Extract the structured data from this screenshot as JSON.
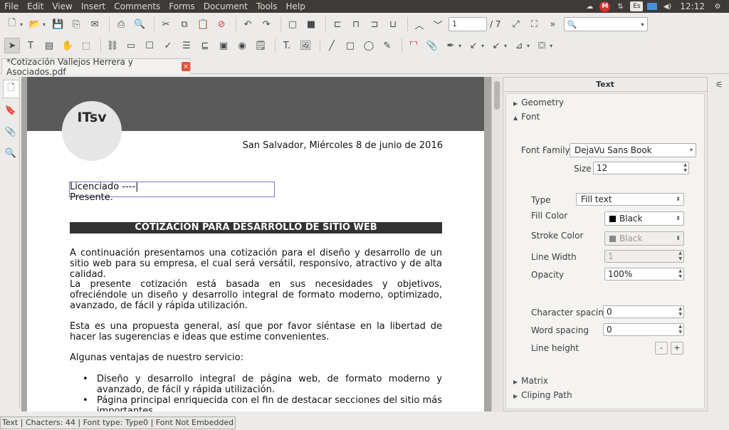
{
  "menu": [
    "File",
    "Edit",
    "View",
    "Insert",
    "Comments",
    "Forms",
    "Document",
    "Tools",
    "Help"
  ],
  "tray": {
    "language": "Es",
    "time": "12:12",
    "m_badge": "M"
  },
  "toolbar": {
    "page_current": "1",
    "page_total": "/ 7",
    "search_value": ""
  },
  "tab": {
    "title": "*Cotización Vallejos Herrera y Asociados.pdf",
    "close": "×"
  },
  "document": {
    "logo": "ITsv",
    "date_line": "San Salvador, Miércoles 8 de junio de 2016",
    "addressee": "Licenciado ----|",
    "salutation": "Presente.",
    "section_title": "COTIZACIÓN PARA DESARROLLO DE SITIO WEB",
    "paragraphs": [
      "A continuación presentamos una cotización para el diseño y desarrollo de un sitio web para su empresa, el cual será versátil, responsivo, atractivo y de alta calidad.",
      "La presente cotización está basada en sus necesidades y objetivos, ofreciéndole un diseño y desarrollo integral de formato moderno, optimizado, avanzado, de fácil y rápida utilización.",
      "Esta es una propuesta general, así que por favor siéntase en la libertad de hacer las sugerencias e ideas que estime convenientes.",
      "Algunas ventajas de nuestro servicio:"
    ],
    "bullets": [
      "Diseño y desarrollo integral de página web, de formato moderno y avanzado, de fácil y rápida utilización.",
      "Página principal enriquecida con el fin de destacar secciones del sitio más importantes."
    ]
  },
  "panel": {
    "title": "Text",
    "geometry": "Geometry",
    "font": "Font",
    "font_family_label": "Font Family",
    "font_family_value": "DejaVu Sans Book",
    "size_label": "Size",
    "size_value": "12",
    "type_label": "Type",
    "type_value": "Fill text",
    "fill_color_label": "Fill Color",
    "fill_color_value": "Black",
    "stroke_color_label": "Stroke Color",
    "stroke_color_value": "Black",
    "line_width_label": "Line Width",
    "line_width_value": "1",
    "opacity_label": "Opacity",
    "opacity_value": "100%",
    "char_spacing_label": "Character spacing",
    "char_spacing_value": "0",
    "word_spacing_label": "Word spacing",
    "word_spacing_value": "0",
    "line_height_label": "Line height",
    "line_height_minus": "-",
    "line_height_plus": "+",
    "matrix": "Matrix",
    "clipping_path": "Cliping Path"
  },
  "status": {
    "text": "Text | Chacters: 44 | Font type: Type0 | Font Not Embedded"
  },
  "colors": {
    "menubar_bg": "#3c3b37",
    "page_header": "#5a5a5a",
    "title_bar": "#333333",
    "tab_close": "#e0553a"
  }
}
